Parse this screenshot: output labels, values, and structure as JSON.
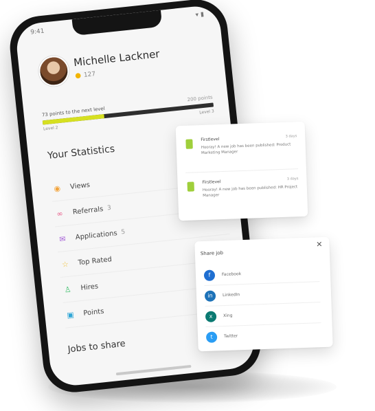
{
  "profile": {
    "name": "Michelle Lackner",
    "points": "127"
  },
  "progress": {
    "label": "73 points to the next level",
    "max": "200 points",
    "fraction": 0.36,
    "level_current": "Level 2",
    "level_next": "Level 3",
    "fill_color": "#d6e021"
  },
  "statistics": {
    "title": "Your Statistics",
    "items": [
      {
        "label": "Views",
        "count": "",
        "icon": "eye-icon",
        "color": "#f2a33a"
      },
      {
        "label": "Referrals",
        "count": "3",
        "icon": "link-icon",
        "color": "#e85d8a"
      },
      {
        "label": "Applications",
        "count": "5",
        "icon": "mail-icon",
        "color": "#a35bd6"
      },
      {
        "label": "Top Rated",
        "count": "",
        "icon": "star-icon",
        "color": "#f2c23a"
      },
      {
        "label": "Hires",
        "count": "",
        "icon": "user-icon",
        "color": "#3bbf6a"
      },
      {
        "label": "Points",
        "count": "",
        "icon": "gift-icon",
        "color": "#2fa6d6"
      }
    ]
  },
  "jobs": {
    "title": "Jobs to share"
  },
  "notifications": [
    {
      "title": "Firstlevel",
      "time": "3 days",
      "text": "Hooray! A new job has been published: Product Marketing Manager"
    },
    {
      "title": "Firstlevel",
      "time": "3 days",
      "text": "Hooray! A new job has been published: HR Project Manager"
    }
  ],
  "share": {
    "title": "Share job",
    "close": "✕",
    "options": [
      {
        "label": "Facebook",
        "icon": "facebook-icon",
        "glyph": "f",
        "color": "#1f6fd1"
      },
      {
        "label": "LinkedIn",
        "icon": "linkedin-icon",
        "glyph": "in",
        "color": "#1d72b8"
      },
      {
        "label": "Xing",
        "icon": "xing-icon",
        "glyph": "x",
        "color": "#0b7a72"
      },
      {
        "label": "Twitter",
        "icon": "twitter-icon",
        "glyph": "t",
        "color": "#2a9df4"
      }
    ]
  },
  "statusbar": {
    "left": "9:41",
    "right": "▾ ▮"
  }
}
